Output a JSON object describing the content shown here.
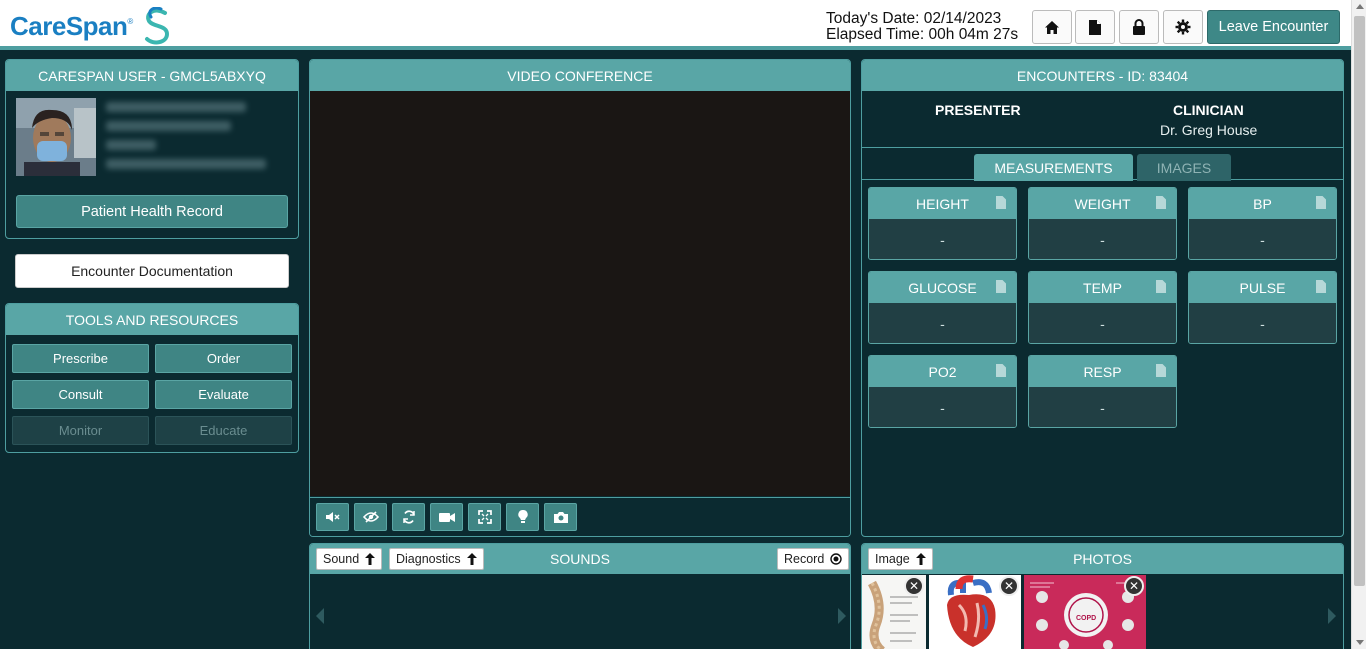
{
  "header": {
    "logo_text": "CareSpan",
    "logo_reg": "®",
    "date_label": "Today's Date: 02/14/2023",
    "elapsed_label": "Elapsed Time: 00h 04m 27s",
    "icons": [
      "home-icon",
      "document-icon",
      "lock-icon",
      "gear-icon"
    ],
    "leave_button": "Leave Encounter"
  },
  "user_panel": {
    "title": "CARESPAN USER - GMCL5ABXYQ",
    "patient_record_button": "Patient Health Record"
  },
  "encounter_doc_button": "Encounter Documentation",
  "tools": {
    "title": "TOOLS AND RESOURCES",
    "buttons": [
      {
        "label": "Prescribe",
        "enabled": true
      },
      {
        "label": "Order",
        "enabled": true
      },
      {
        "label": "Consult",
        "enabled": true
      },
      {
        "label": "Evaluate",
        "enabled": true
      },
      {
        "label": "Monitor",
        "enabled": false
      },
      {
        "label": "Educate",
        "enabled": false
      }
    ]
  },
  "video": {
    "title": "VIDEO CONFERENCE",
    "controls": [
      "mute-icon",
      "hide-video-icon",
      "switch-camera-icon",
      "camera-icon",
      "fullscreen-icon",
      "light-icon",
      "snapshot-icon"
    ]
  },
  "sounds": {
    "title": "SOUNDS",
    "sound_button": "Sound",
    "diagnostics_button": "Diagnostics",
    "record_button": "Record"
  },
  "encounters": {
    "title": "ENCOUNTERS - ID: 83404",
    "presenter_label": "PRESENTER",
    "clinician_label": "CLINICIAN",
    "clinician_name": "Dr. Greg House",
    "tabs": [
      "MEASUREMENTS",
      "IMAGES"
    ],
    "active_tab": "MEASUREMENTS",
    "measurements": [
      {
        "name": "HEIGHT",
        "value": "-"
      },
      {
        "name": "WEIGHT",
        "value": "-"
      },
      {
        "name": "BP",
        "value": "-"
      },
      {
        "name": "GLUCOSE",
        "value": "-"
      },
      {
        "name": "TEMP",
        "value": "-"
      },
      {
        "name": "PULSE",
        "value": "-"
      },
      {
        "name": "PO2",
        "value": "-"
      },
      {
        "name": "RESP",
        "value": "-"
      }
    ]
  },
  "photos": {
    "title": "PHOTOS",
    "image_button": "Image",
    "thumbnail_texts": [
      "COPD"
    ]
  },
  "colors": {
    "accent": "#59a6a6",
    "background": "#0b2a30",
    "button": "#3f8584",
    "brand_blue": "#1a7fc2"
  }
}
